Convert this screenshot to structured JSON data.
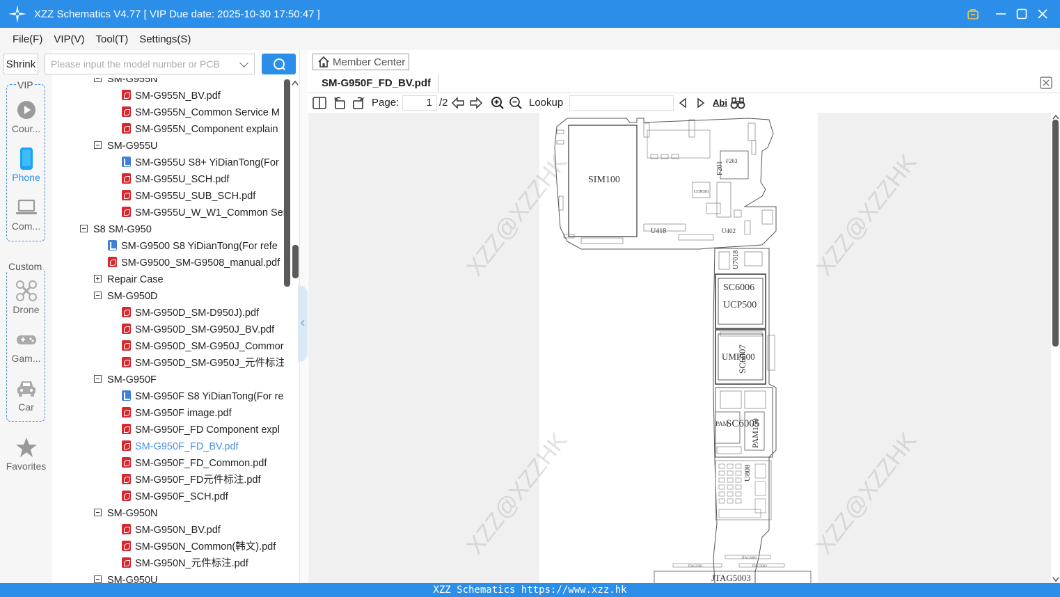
{
  "window": {
    "title": "XZZ Schematics V4.77 [ VIP Due date: 2025-10-30 17:50:47 ]"
  },
  "menu": {
    "items": [
      "File(F)",
      "VIP(V)",
      "Tool(T)",
      "Settings(S)"
    ]
  },
  "search": {
    "shrink_label": "Shrink",
    "placeholder": "Please input the model number or PCB"
  },
  "sidebar": {
    "vip_group_label": "VIP",
    "vip_items": [
      {
        "label": "Cour...",
        "icon": "play-circle-icon"
      },
      {
        "label": "Phone",
        "icon": "phone-icon",
        "active": true
      },
      {
        "label": "Com...",
        "icon": "laptop-icon"
      }
    ],
    "custom_group_label": "Custom",
    "custom_items": [
      {
        "label": "Drone",
        "icon": "drone-icon"
      },
      {
        "label": "Gam...",
        "icon": "gamepad-icon"
      },
      {
        "label": "Car",
        "icon": "car-icon"
      }
    ],
    "favorites_label": "Favorites",
    "accent_color": "#2b8fea"
  },
  "tree": {
    "rows": [
      {
        "level": 1,
        "type": "folder",
        "label": "SM-G955N"
      },
      {
        "level": 2,
        "type": "pdf",
        "label": "SM-G955N_BV.pdf"
      },
      {
        "level": 2,
        "type": "pdf",
        "label": "SM-G955N_Common Service M"
      },
      {
        "level": 2,
        "type": "pdf",
        "label": "SM-G955N_Component explain"
      },
      {
        "level": 1,
        "type": "folder",
        "label": "SM-G955U"
      },
      {
        "level": 2,
        "type": "doc",
        "label": "SM-G955U S8+ YiDianTong(For"
      },
      {
        "level": 2,
        "type": "pdf",
        "label": "SM-G955U_SCH.pdf"
      },
      {
        "level": 2,
        "type": "pdf",
        "label": "SM-G955U_SUB_SCH.pdf"
      },
      {
        "level": 2,
        "type": "pdf",
        "label": "SM-G955U_W_W1_Common Ser"
      },
      {
        "level": 0,
        "type": "folder",
        "label": "S8 SM-G950"
      },
      {
        "level": 1,
        "type": "doc",
        "label": "SM-G9500 S8 YiDianTong(For refe"
      },
      {
        "level": 1,
        "type": "pdf",
        "label": "SM-G9500_SM-G9508_manual.pdf"
      },
      {
        "level": 1,
        "type": "folder-collapsed",
        "label": "Repair Case"
      },
      {
        "level": 1,
        "type": "folder",
        "label": "SM-G950D"
      },
      {
        "level": 2,
        "type": "pdf",
        "label": "SM-G950D_SM-D950J).pdf"
      },
      {
        "level": 2,
        "type": "pdf",
        "label": "SM-G950D_SM-G950J_BV.pdf"
      },
      {
        "level": 2,
        "type": "pdf",
        "label": "SM-G950D_SM-G950J_Commor"
      },
      {
        "level": 2,
        "type": "pdf",
        "label": "SM-G950D_SM-G950J_元件标注."
      },
      {
        "level": 1,
        "type": "folder",
        "label": "SM-G950F"
      },
      {
        "level": 2,
        "type": "doc",
        "label": "SM-G950F S8 YiDianTong(For re"
      },
      {
        "level": 2,
        "type": "pdf",
        "label": "SM-G950F image.pdf"
      },
      {
        "level": 2,
        "type": "pdf",
        "label": "SM-G950F_FD Component expl"
      },
      {
        "level": 2,
        "type": "pdf",
        "label": "SM-G950F_FD_BV.pdf",
        "selected": true
      },
      {
        "level": 2,
        "type": "pdf",
        "label": "SM-G950F_FD_Common.pdf"
      },
      {
        "level": 2,
        "type": "pdf",
        "label": "SM-G950F_FD元件标注.pdf"
      },
      {
        "level": 2,
        "type": "pdf",
        "label": "SM-G950F_SCH.pdf"
      },
      {
        "level": 1,
        "type": "folder",
        "label": "SM-G950N"
      },
      {
        "level": 2,
        "type": "pdf",
        "label": "SM-G950N_BV.pdf"
      },
      {
        "level": 2,
        "type": "pdf",
        "label": "SM-G950N_Common(韩文).pdf"
      },
      {
        "level": 2,
        "type": "pdf",
        "label": "SM-G950N_元件标注.pdf"
      },
      {
        "level": 1,
        "type": "folder",
        "label": "SM-G950U"
      }
    ]
  },
  "viewer": {
    "member_center_label": "Member Center",
    "tab_label": "SM-G950F_FD_BV.pdf",
    "page_label": "Page:",
    "current_page": "1",
    "total_pages": "/2",
    "lookup_label": "Lookup",
    "abi_label": "Abi",
    "watermark": "XZZ@XZZHK"
  },
  "schematic": {
    "labels": [
      "SIM100",
      "F201",
      "F203",
      "CON301",
      "U418",
      "U402",
      "U7018",
      "SC6006",
      "UCP500",
      "UMP500",
      "SC6007",
      "PAM",
      "SC6005",
      "PAM150",
      "U808",
      "JTAG5003",
      "JTAG5001",
      "JTAG5002",
      "JTAG5000"
    ]
  },
  "statusbar": {
    "text": "XZZ Schematics https://www.xzz.hk"
  }
}
